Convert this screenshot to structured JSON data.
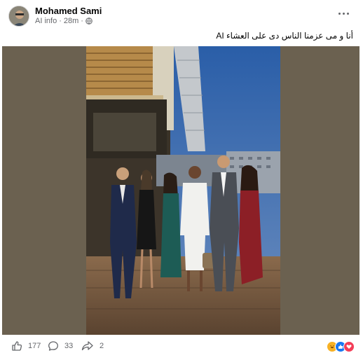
{
  "post": {
    "author": "Mohamed Sami",
    "subtitle": "AI info",
    "time": "28m",
    "caption": "أنا و مى عزمنا الناس دى على العشاء AI",
    "likes": "177",
    "comments": "33",
    "shares": "2"
  },
  "icons": {
    "more": "more-options-icon",
    "globe": "globe-icon",
    "like": "thumbs-up-icon",
    "comment": "comment-bubble-icon",
    "share": "share-arrow-icon",
    "reactions": [
      "haha-reaction-icon",
      "like-reaction-icon",
      "love-reaction-icon"
    ]
  },
  "colors": {
    "photo_background": "#6b6150",
    "meta_text": "#65676b",
    "like_blue": "#1877f2",
    "love_red": "#f33e58",
    "haha_yellow": "#f7b125"
  }
}
